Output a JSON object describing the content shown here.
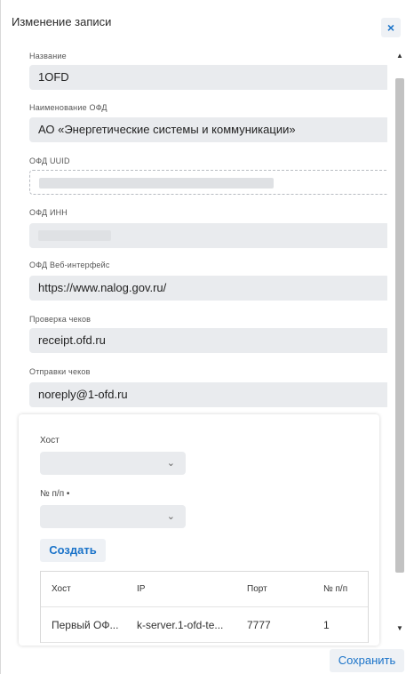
{
  "dialog": {
    "title": "Изменение записи",
    "close_icon": "×"
  },
  "fields": [
    {
      "label": "Название",
      "value": "1OFD"
    },
    {
      "label": "Наименование ОФД",
      "value": "АО «Энергетические системы и коммуникации»"
    },
    {
      "label": "ОФД UUID",
      "value": ""
    },
    {
      "label": "ОФД ИНН",
      "value": ""
    },
    {
      "label": "ОФД Веб-интерфейс",
      "value": "https://www.nalog.gov.ru/"
    },
    {
      "label": "Проверка чеков",
      "value": "receipt.ofd.ru"
    },
    {
      "label": "Отправки чеков",
      "value": "noreply@1-ofd.ru"
    }
  ],
  "hosts_panel": {
    "host_label": "Хост",
    "host_value": "",
    "number_label": "№ п/п •",
    "number_value": "",
    "create_label": "Создать",
    "table": {
      "headers": [
        "Хост",
        "IP",
        "Порт",
        "№ п/п"
      ],
      "rows": [
        [
          "Первый ОФ...",
          "k-server.1-ofd-te...",
          "7777",
          "1"
        ]
      ]
    }
  },
  "footer": {
    "save_label": "Сохранить"
  },
  "icons": {
    "chevron": "chevron-down-icon",
    "close": "close-icon"
  },
  "colors": {
    "accent": "#1a73c9",
    "field_bg": "#e9ebee"
  }
}
